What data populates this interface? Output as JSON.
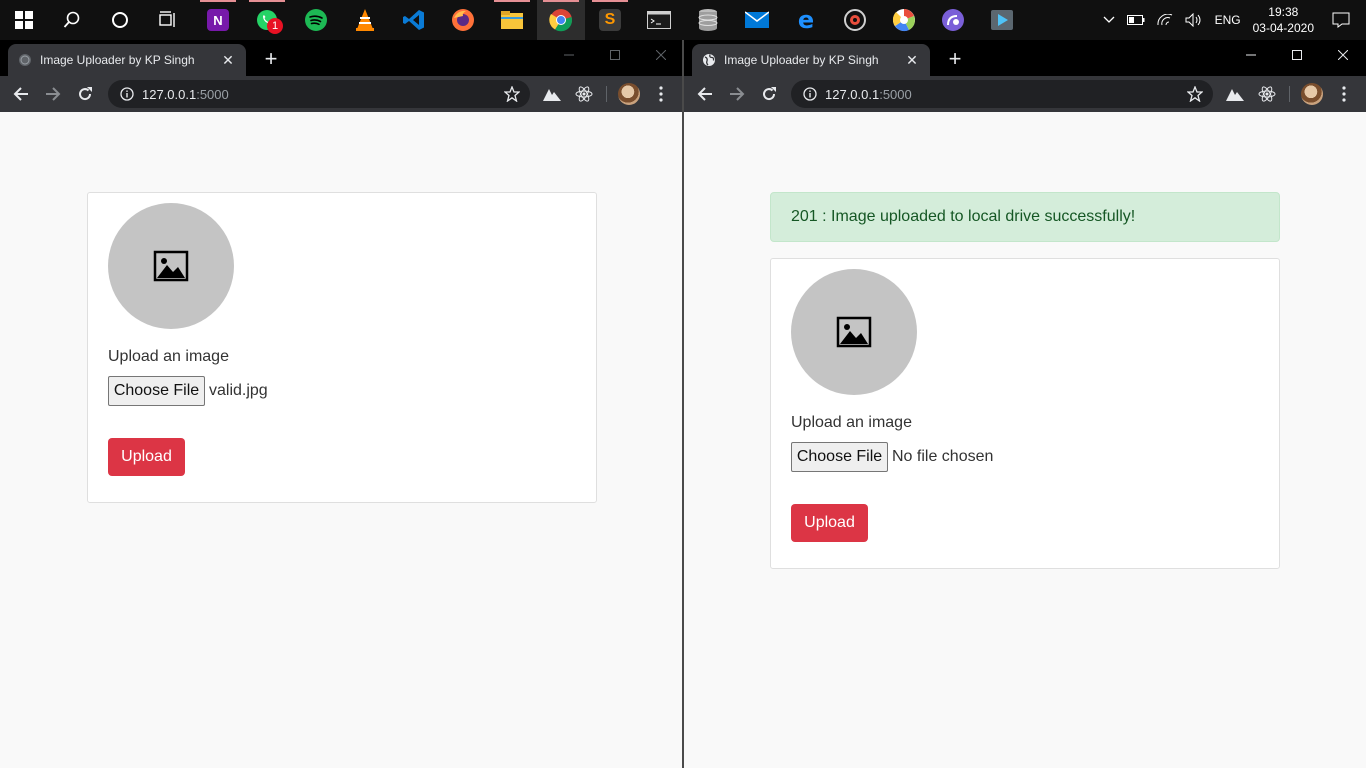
{
  "taskbar": {
    "apps": [
      {
        "name": "windows-start-icon",
        "glyph": "",
        "color": "#ffffff"
      },
      {
        "name": "search-icon",
        "glyph": "",
        "color": "#ffffff"
      },
      {
        "name": "cortana-icon",
        "glyph": "",
        "color": "#ffffff"
      },
      {
        "name": "task-view-icon",
        "glyph": "",
        "color": "#ffffff"
      },
      {
        "name": "onenote-icon",
        "glyph": "N",
        "color": "#7719aa"
      },
      {
        "name": "whatsapp-icon",
        "glyph": "",
        "color": "#25d366"
      },
      {
        "name": "spotify-icon",
        "glyph": "",
        "color": "#1db954"
      },
      {
        "name": "vlc-icon",
        "glyph": "",
        "color": "#ff8800"
      },
      {
        "name": "vscode-icon",
        "glyph": "",
        "color": "#0a7bd6"
      },
      {
        "name": "firefox-icon",
        "glyph": "",
        "color": "#ff7139"
      },
      {
        "name": "file-explorer-icon",
        "glyph": "",
        "color": "#f8c53a"
      },
      {
        "name": "chrome-icon",
        "glyph": "",
        "color": "#4285f4"
      },
      {
        "name": "sublime-text-icon",
        "glyph": "S",
        "color": "#ff9800"
      },
      {
        "name": "terminal-icon",
        "glyph": "",
        "color": "#2b2b2b"
      },
      {
        "name": "database-icon",
        "glyph": "",
        "color": "#9e9e9e"
      },
      {
        "name": "mail-icon",
        "glyph": "",
        "color": "#0078d7"
      },
      {
        "name": "edge-icon",
        "glyph": "e",
        "color": "#0078d7"
      },
      {
        "name": "groove-music-icon",
        "glyph": "",
        "color": "#e94e3c"
      },
      {
        "name": "picasa-icon",
        "glyph": "",
        "color": "#9bd15a"
      },
      {
        "name": "bittorrent-icon",
        "glyph": "",
        "color": "#7a5fd8"
      },
      {
        "name": "media-player-icon",
        "glyph": "",
        "color": "#1e88e5"
      }
    ],
    "whatsapp_badge": "1",
    "language": "ENG",
    "time": "19:38",
    "date": "03-04-2020"
  },
  "left_window": {
    "tab_title": "Image Uploader by KP Singh",
    "url_host": "127.0.0.1",
    "url_port": ":5000",
    "upload_label": "Upload an image",
    "choose_file_label": "Choose File",
    "file_name": "valid.jpg",
    "upload_button": "Upload"
  },
  "right_window": {
    "tab_title": "Image Uploader by KP Singh",
    "url_host": "127.0.0.1",
    "url_port": ":5000",
    "alert_message": "201 : Image uploaded to local drive successfully!",
    "upload_label": "Upload an image",
    "choose_file_label": "Choose File",
    "file_name": "No file chosen",
    "upload_button": "Upload"
  },
  "colors": {
    "upload_button": "#dc3545",
    "alert_bg": "#d4edda",
    "alert_text": "#155724",
    "placeholder_circle": "#c4c4c4"
  }
}
